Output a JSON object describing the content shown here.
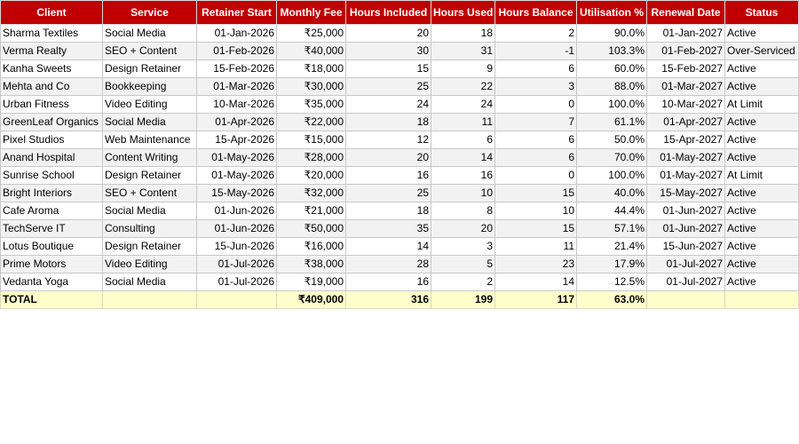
{
  "columns": [
    "Client",
    "Service",
    "Retainer Start",
    "Monthly Fee",
    "Hours Included",
    "Hours Used",
    "Hours Balance",
    "Utilisation %",
    "Renewal Date",
    "Status"
  ],
  "rows": [
    [
      "Sharma Textiles",
      "Social Media",
      "01-Jan-2026",
      "₹25,000",
      "20",
      "18",
      "2",
      "90.0%",
      "01-Jan-2027",
      "Active"
    ],
    [
      "Verma Realty",
      "SEO + Content",
      "01-Feb-2026",
      "₹40,000",
      "30",
      "31",
      "-1",
      "103.3%",
      "01-Feb-2027",
      "Over-Serviced"
    ],
    [
      "Kanha Sweets",
      "Design Retainer",
      "15-Feb-2026",
      "₹18,000",
      "15",
      "9",
      "6",
      "60.0%",
      "15-Feb-2027",
      "Active"
    ],
    [
      "Mehta and Co",
      "Bookkeeping",
      "01-Mar-2026",
      "₹30,000",
      "25",
      "22",
      "3",
      "88.0%",
      "01-Mar-2027",
      "Active"
    ],
    [
      "Urban Fitness",
      "Video Editing",
      "10-Mar-2026",
      "₹35,000",
      "24",
      "24",
      "0",
      "100.0%",
      "10-Mar-2027",
      "At Limit"
    ],
    [
      "GreenLeaf Organics",
      "Social Media",
      "01-Apr-2026",
      "₹22,000",
      "18",
      "11",
      "7",
      "61.1%",
      "01-Apr-2027",
      "Active"
    ],
    [
      "Pixel Studios",
      "Web Maintenance",
      "15-Apr-2026",
      "₹15,000",
      "12",
      "6",
      "6",
      "50.0%",
      "15-Apr-2027",
      "Active"
    ],
    [
      "Anand Hospital",
      "Content Writing",
      "01-May-2026",
      "₹28,000",
      "20",
      "14",
      "6",
      "70.0%",
      "01-May-2027",
      "Active"
    ],
    [
      "Sunrise School",
      "Design Retainer",
      "01-May-2026",
      "₹20,000",
      "16",
      "16",
      "0",
      "100.0%",
      "01-May-2027",
      "At Limit"
    ],
    [
      "Bright Interiors",
      "SEO + Content",
      "15-May-2026",
      "₹32,000",
      "25",
      "10",
      "15",
      "40.0%",
      "15-May-2027",
      "Active"
    ],
    [
      "Cafe Aroma",
      "Social Media",
      "01-Jun-2026",
      "₹21,000",
      "18",
      "8",
      "10",
      "44.4%",
      "01-Jun-2027",
      "Active"
    ],
    [
      "TechServe IT",
      "Consulting",
      "01-Jun-2026",
      "₹50,000",
      "35",
      "20",
      "15",
      "57.1%",
      "01-Jun-2027",
      "Active"
    ],
    [
      "Lotus Boutique",
      "Design Retainer",
      "15-Jun-2026",
      "₹16,000",
      "14",
      "3",
      "11",
      "21.4%",
      "15-Jun-2027",
      "Active"
    ],
    [
      "Prime Motors",
      "Video Editing",
      "01-Jul-2026",
      "₹38,000",
      "28",
      "5",
      "23",
      "17.9%",
      "01-Jul-2027",
      "Active"
    ],
    [
      "Vedanta Yoga",
      "Social Media",
      "01-Jul-2026",
      "₹19,000",
      "16",
      "2",
      "14",
      "12.5%",
      "01-Jul-2027",
      "Active"
    ]
  ],
  "total": [
    "TOTAL",
    "",
    "",
    "₹409,000",
    "316",
    "199",
    "117",
    "63.0%",
    "",
    ""
  ],
  "colors": {
    "header_bg": "#c00000",
    "header_text": "#ffffff",
    "total_bg": "#ffffcc",
    "stripe_bg": "#f2f2f2"
  }
}
